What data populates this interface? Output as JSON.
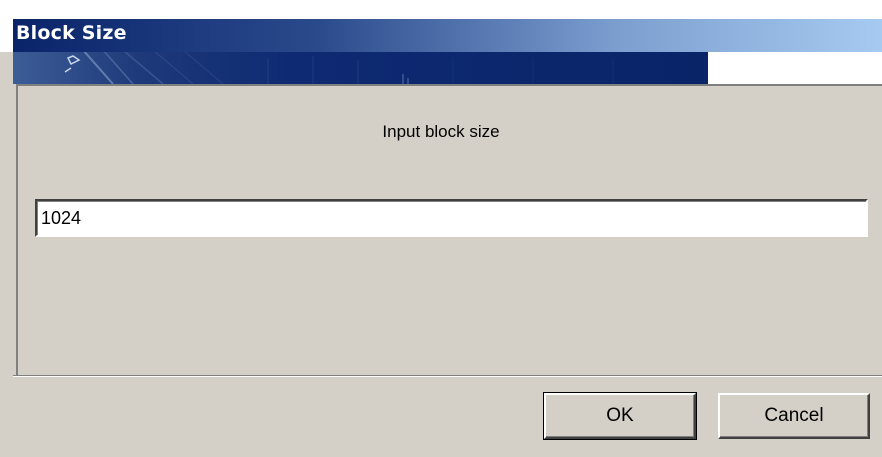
{
  "window": {
    "title": "Block Size"
  },
  "dialog": {
    "prompt": "Input block size",
    "input_value": "1024",
    "ok_label": "OK",
    "cancel_label": "Cancel"
  },
  "colors": {
    "title_gradient_start": "#0a246a",
    "title_gradient_end": "#a6caf0",
    "dialog_background": "#d4d0c8"
  }
}
